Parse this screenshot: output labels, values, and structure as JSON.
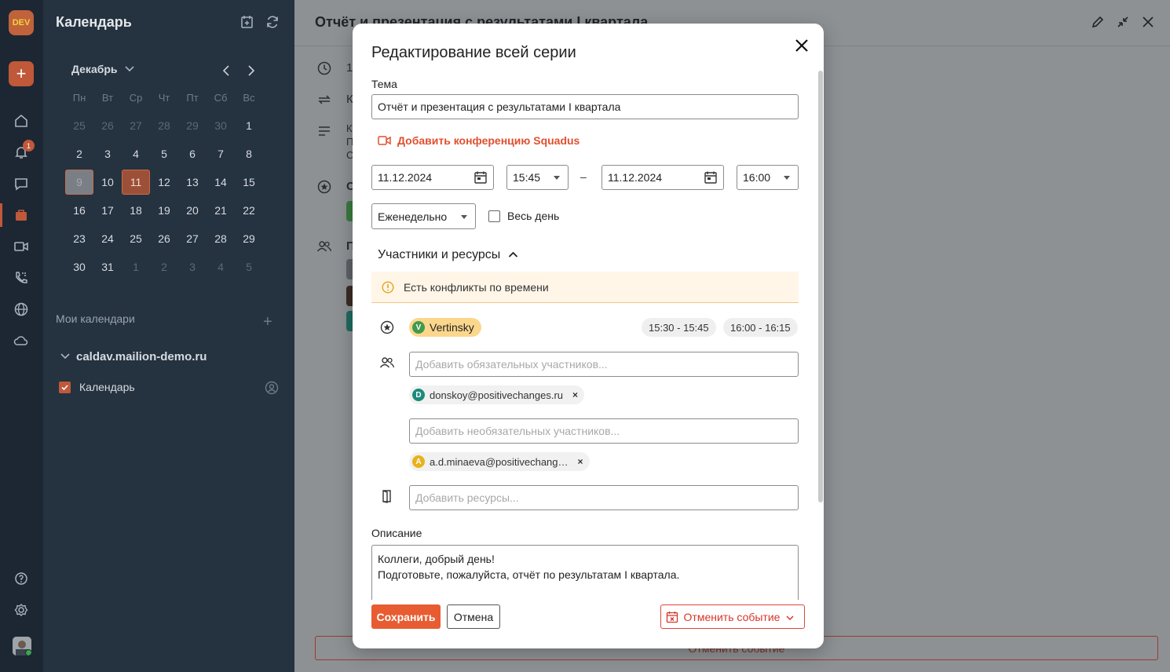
{
  "rail": {
    "logo_text": "DEV",
    "notifications_count": "1",
    "icons": [
      "plus-icon",
      "home-icon",
      "bell-icon",
      "chat-icon",
      "briefcase-icon",
      "video-icon",
      "phone-icon",
      "globe-icon",
      "cloud-icon",
      "help-icon",
      "settings-icon"
    ]
  },
  "calendar_panel": {
    "title": "Календарь",
    "month_label": "Декабрь",
    "weekdays": [
      "Пн",
      "Вт",
      "Ср",
      "Чт",
      "Пт",
      "Сб",
      "Вс"
    ],
    "weeks": [
      [
        "25",
        "26",
        "27",
        "28",
        "29",
        "30",
        "1"
      ],
      [
        "2",
        "3",
        "4",
        "5",
        "6",
        "7",
        "8"
      ],
      [
        "9",
        "10",
        "11",
        "12",
        "13",
        "14",
        "15"
      ],
      [
        "16",
        "17",
        "18",
        "19",
        "20",
        "21",
        "22"
      ],
      [
        "23",
        "24",
        "25",
        "26",
        "27",
        "28",
        "29"
      ],
      [
        "30",
        "31",
        "1",
        "2",
        "3",
        "4",
        "5"
      ]
    ],
    "my_calendars_label": "Мои календари",
    "server_name": "caldav.mailion-demo.ru",
    "calendar_item": "Календарь"
  },
  "background_view": {
    "event_title": "Отчёт и презентация с результатами I квартала",
    "fragments": [
      "1",
      "К",
      "К",
      "П",
      "С",
      "С",
      "П"
    ],
    "cancel_label": "Отменить событие"
  },
  "modal": {
    "title": "Редактирование всей серии",
    "subject_label": "Тема",
    "subject_value": "Отчёт и презентация с результатами I квартала",
    "conference_link": "Добавить конференцию Squadus",
    "start_date": "11.12.2024",
    "start_time": "15:45",
    "dash": "–",
    "end_date": "11.12.2024",
    "end_time": "16:00",
    "recurrence": "Еженедельно",
    "all_day_label": "Весь день",
    "participants_section": "Участники и ресурсы",
    "conflict_warning": "Есть конфликты по времени",
    "organizer": {
      "initial": "V",
      "name": "Vertinsky",
      "color": "#3f9a4e"
    },
    "busy_slots": [
      "15:30 - 15:45",
      "16:00 - 16:15"
    ],
    "required_placeholder": "Добавить обязательных участников...",
    "required_participants": [
      {
        "initial": "D",
        "email": "donskoy@positivechanges.ru",
        "color": "#1c8b7b"
      }
    ],
    "optional_placeholder": "Добавить необязательных участников...",
    "optional_participants": [
      {
        "initial": "A",
        "email": "a.d.minaeva@positivechang…",
        "color": "#e8b21a"
      }
    ],
    "resources_placeholder": "Добавить ресурсы...",
    "description_label": "Описание",
    "description_lines": [
      "Коллеги, добрый день!",
      "Подготовьте, пожалуйста, отчёт по результатам I квартала."
    ],
    "save_label": "Сохранить",
    "cancel_label": "Отмена",
    "delete_label": "Отменить событие"
  },
  "colors": {
    "accent": "#e85c32",
    "danger": "#d8352a",
    "warning_bg": "#fff6e8",
    "organizer_chip": "#fbd78c"
  }
}
